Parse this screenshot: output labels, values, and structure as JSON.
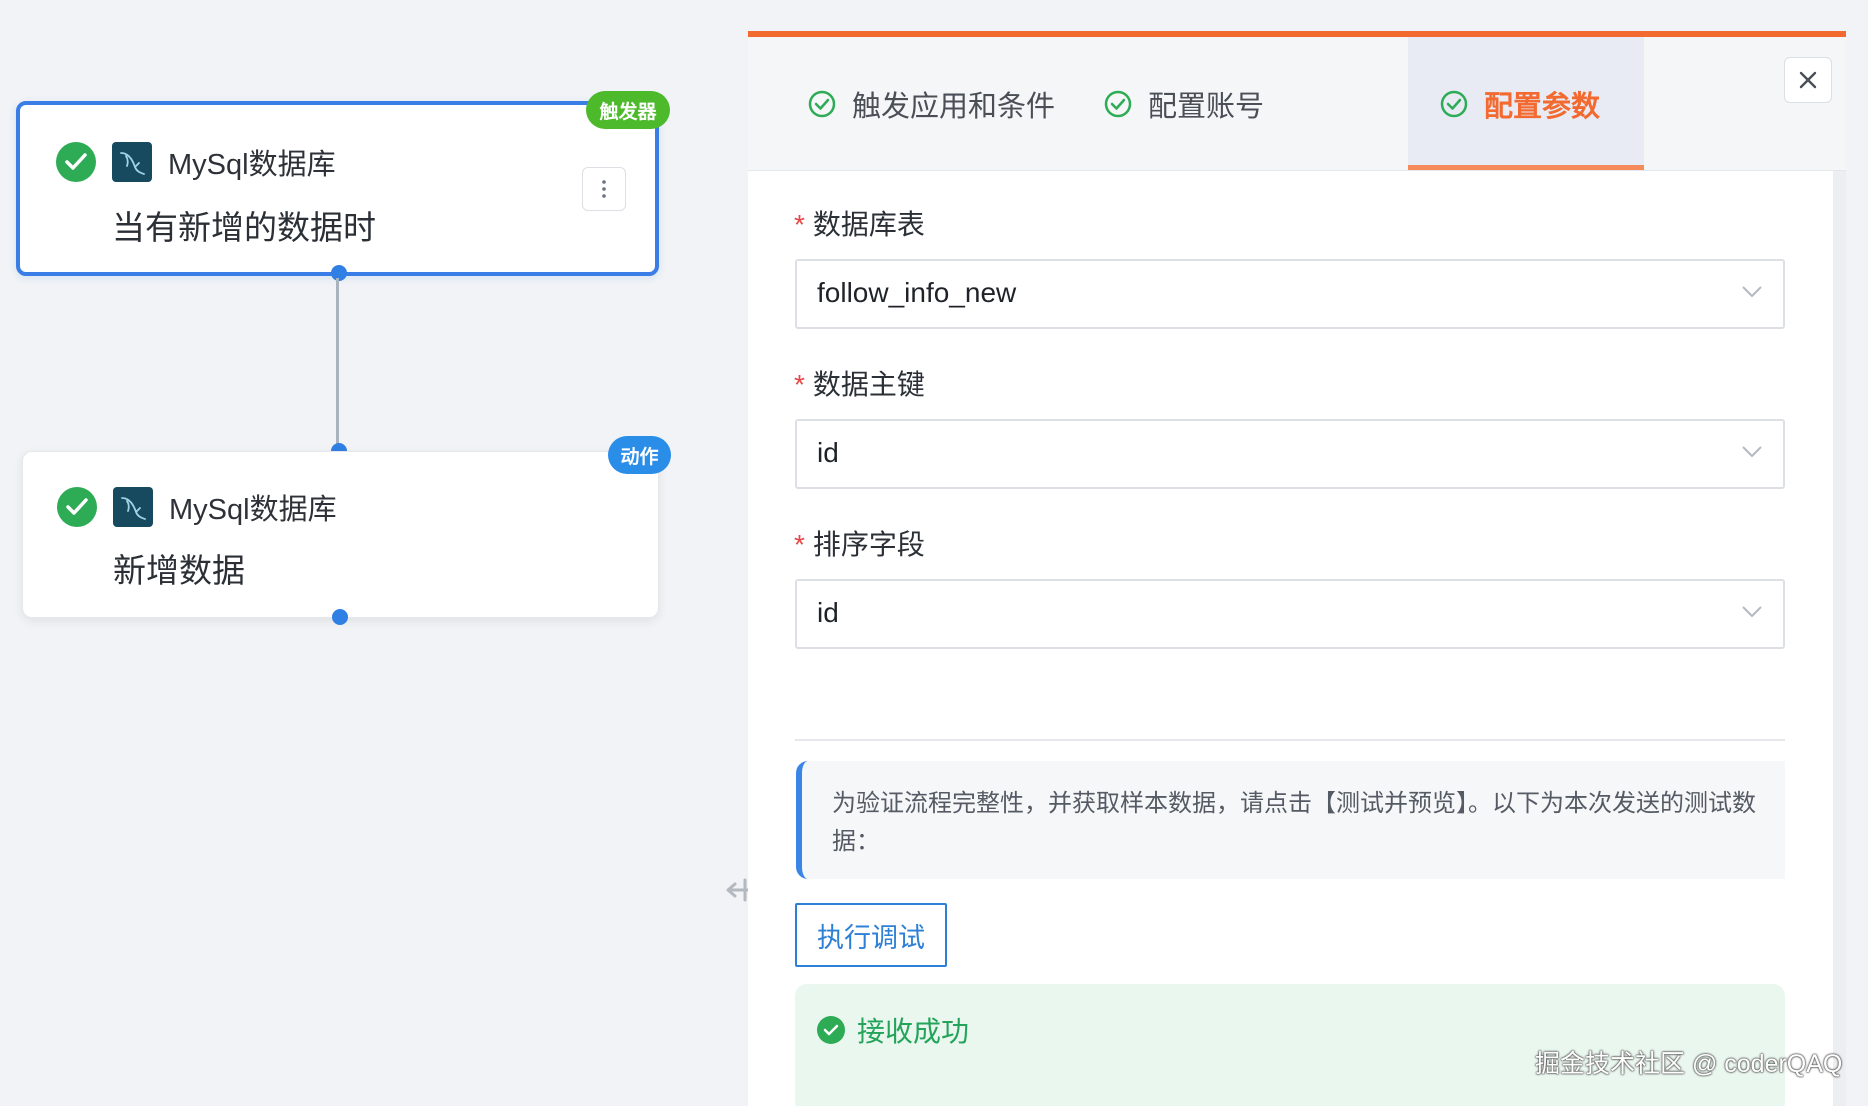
{
  "canvas": {
    "trigger_node": {
      "badge": "触发器",
      "app_name": "MySql数据库",
      "event": "当有新增的数据时",
      "icons": {
        "status": "check-circle-icon",
        "app": "mysql-icon",
        "more": "more-vertical-icon"
      }
    },
    "action_node": {
      "badge": "动作",
      "app_name": "MySql数据库",
      "event": "新增数据",
      "icons": {
        "status": "check-circle-icon",
        "app": "mysql-icon"
      }
    }
  },
  "drawer": {
    "accent_color": "#f36a30",
    "tabs": [
      {
        "label": "触发应用和条件",
        "completed": true,
        "active": false
      },
      {
        "label": "配置账号",
        "completed": true,
        "active": false
      },
      {
        "label": "配置参数",
        "completed": true,
        "active": true
      }
    ],
    "close_icon": "close-icon",
    "fields": [
      {
        "label": "数据库表",
        "required": true,
        "value": "follow_info_new"
      },
      {
        "label": "数据主键",
        "required": true,
        "value": "id"
      },
      {
        "label": "排序字段",
        "required": true,
        "value": "id"
      }
    ],
    "required_mark": "*",
    "notice_text": "为验证流程完整性，并获取样本数据，请点击【测试并预览】。以下为本次发送的测试数据：",
    "run_button": "执行调试",
    "result": {
      "status": "success",
      "text": "接收成功"
    }
  },
  "watermark": "掘金技术社区 @ coderQAQ"
}
